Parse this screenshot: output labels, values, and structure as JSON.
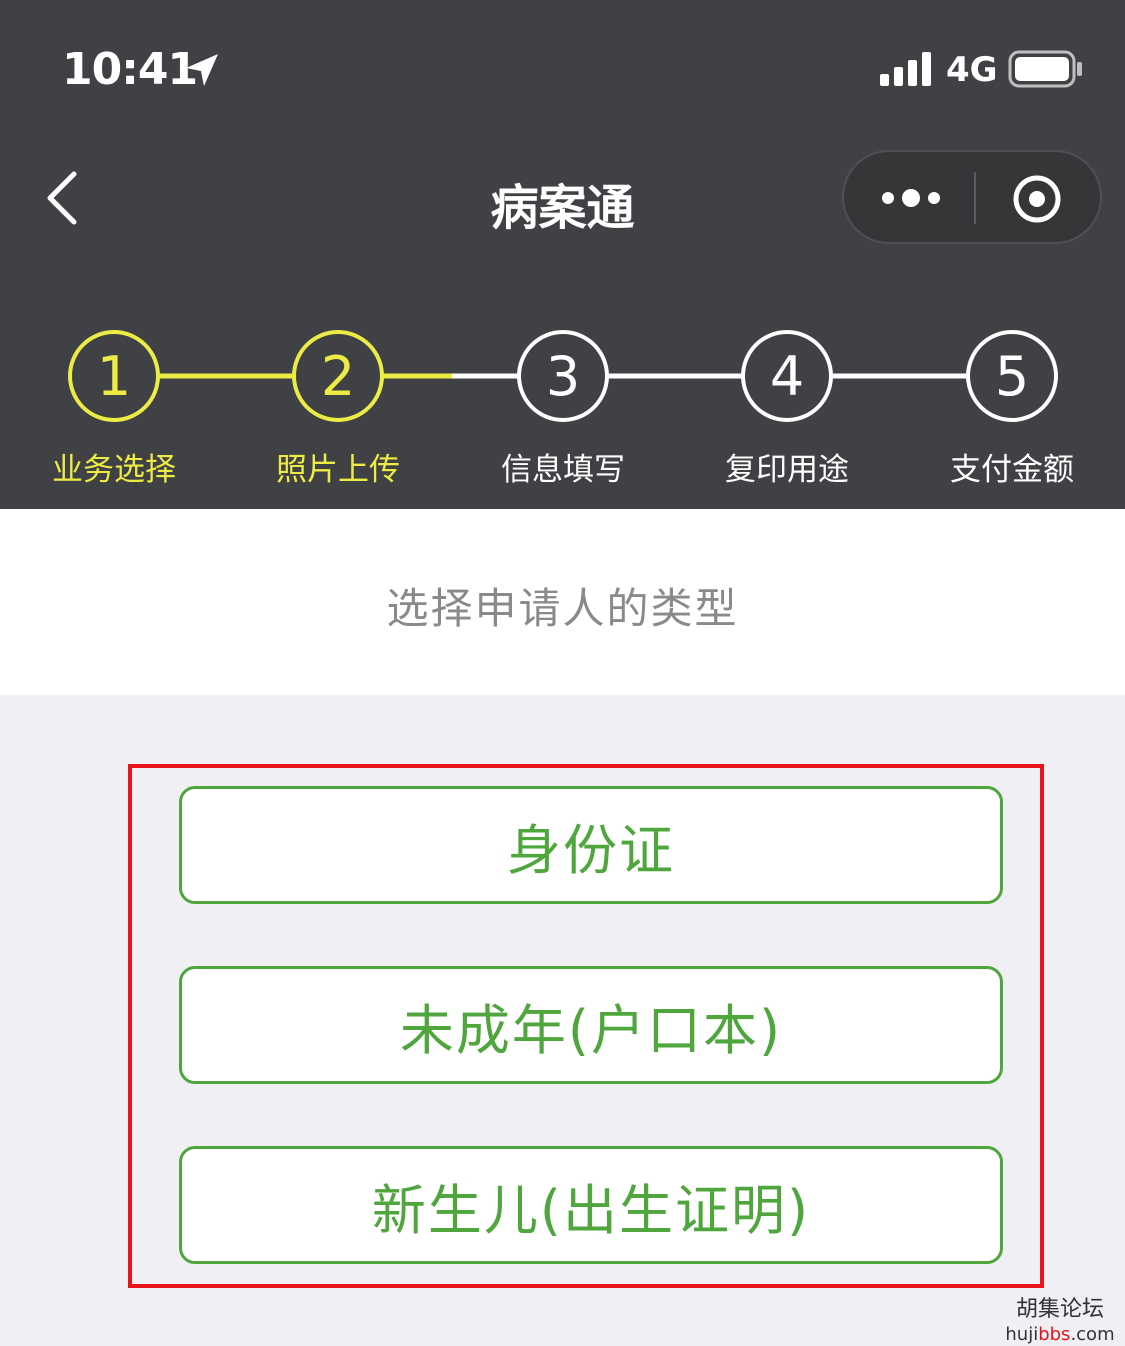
{
  "status": {
    "time": "10:41",
    "network": "4G"
  },
  "nav": {
    "back_icon": "chevron-left-icon",
    "title": "病案通"
  },
  "steps": [
    {
      "number": "1",
      "label": "业务选择",
      "active": true
    },
    {
      "number": "2",
      "label": "照片上传",
      "active": true
    },
    {
      "number": "3",
      "label": "信息填写",
      "active": false
    },
    {
      "number": "4",
      "label": "复印用途",
      "active": false
    },
    {
      "number": "5",
      "label": "支付金额",
      "active": false
    }
  ],
  "section": {
    "heading": "选择申请人的类型"
  },
  "options": [
    {
      "label": "身份证"
    },
    {
      "label": "未成年(户口本)"
    },
    {
      "label": "新生儿(出生证明)"
    }
  ],
  "watermark": {
    "name": "胡集论坛",
    "url_pre": "huji",
    "url_accent": "bbs",
    "url_post": ".com"
  },
  "colors": {
    "header_bg": "#404144",
    "active": "#ecec45",
    "inactive": "#ffffff",
    "option_green": "#4ea63c",
    "highlight": "#e8141c",
    "bg": "#efeff4"
  }
}
